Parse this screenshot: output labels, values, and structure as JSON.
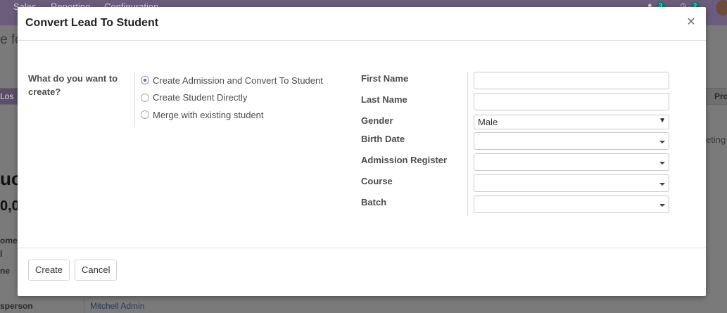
{
  "background": {
    "menu": [
      "Sales",
      "Reporting",
      "Configuration"
    ],
    "badges": [
      "3",
      "2"
    ],
    "page_title_partial": "e fo",
    "lost_button": "Los",
    "tab_right": "Pro",
    "activity_partial": "eting",
    "heading_partial": "uot",
    "amount_partial": "0,0",
    "label_customer_partial": "ome",
    "label_l_partial": "l",
    "label_me_partial": "ne",
    "salesperson_label_partial": "sperson",
    "salesperson_value": "Mitchell Admin"
  },
  "dialog": {
    "title": "Convert Lead To Student",
    "close_symbol": "×",
    "question": "What do you want to create?",
    "options": [
      {
        "label": "Create Admission and Convert To Student",
        "checked": true
      },
      {
        "label": "Create Student Directly",
        "checked": false
      },
      {
        "label": "Merge with existing student",
        "checked": false
      }
    ],
    "fields": {
      "first_name_label": "First Name",
      "first_name_value": "",
      "last_name_label": "Last Name",
      "last_name_value": "",
      "gender_label": "Gender",
      "gender_value": "Male",
      "birth_date_label": "Birth Date",
      "birth_date_value": "",
      "admission_register_label": "Admission Register",
      "admission_register_value": "",
      "course_label": "Course",
      "course_value": "",
      "batch_label": "Batch",
      "batch_value": ""
    },
    "buttons": {
      "create": "Create",
      "cancel": "Cancel"
    }
  }
}
